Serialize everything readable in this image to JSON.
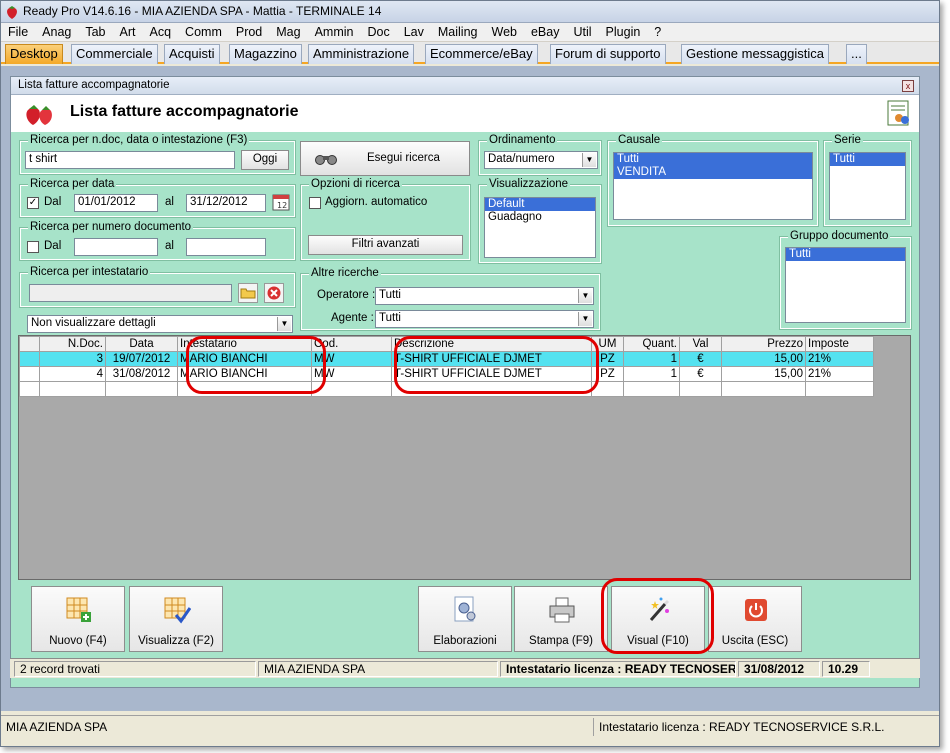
{
  "app": {
    "title": "Ready Pro V14.6.16 - MIA AZIENDA SPA - Mattia - TERMINALE 14"
  },
  "menu": [
    "File",
    "Anag",
    "Tab",
    "Art",
    "Acq",
    "Comm",
    "Prod",
    "Mag",
    "Ammin",
    "Doc",
    "Lav",
    "Mailing",
    "Web",
    "eBay",
    "Util",
    "Plugin",
    "?"
  ],
  "tabs": [
    "Desktop",
    "Commerciale",
    "Acquisti",
    "Magazzino",
    "Amministrazione",
    "Ecommerce/eBay",
    "Forum di supporto",
    "Gestione messaggistica",
    "..."
  ],
  "window": {
    "title": "Lista fatture accompagnatorie",
    "heading": "Lista fatture accompagnatorie",
    "close_glyph": "x"
  },
  "search": {
    "legend": "Ricerca per n.doc, data o intestazione (F3)",
    "value": "t shirt",
    "today_button": "Oggi",
    "execute_button": "Esegui ricerca"
  },
  "date_search": {
    "legend": "Ricerca per data",
    "from_label": "Dal",
    "from_checked": true,
    "from": "01/01/2012",
    "to_label": "al",
    "to": "31/12/2012"
  },
  "number_search": {
    "legend": "Ricerca per numero documento",
    "from_label": "Dal",
    "to_label": "al"
  },
  "holder_search": {
    "legend": "Ricerca per intestatario"
  },
  "details_select": "Non visualizzare dettagli",
  "options": {
    "legend": "Opzioni di ricerca",
    "auto_update": "Aggiorn. automatico",
    "advanced_filters": "Filtri avanzati"
  },
  "other_search": {
    "legend": "Altre ricerche",
    "operator_label": "Operatore :",
    "operator_value": "Tutti",
    "agent_label": "Agente :",
    "agent_value": "Tutti"
  },
  "ordering": {
    "legend": "Ordinamento",
    "value": "Data/numero"
  },
  "view": {
    "legend": "Visualizzazione",
    "items": [
      "Default",
      "Guadagno"
    ]
  },
  "causale": {
    "legend": "Causale",
    "items": [
      "Tutti",
      "VENDITA"
    ]
  },
  "serie": {
    "legend": "Serie",
    "items": [
      "Tutti"
    ]
  },
  "doc_group": {
    "legend": "Gruppo documento",
    "items": [
      "Tutti"
    ]
  },
  "grid": {
    "columns": [
      "",
      "N.Doc.",
      "Data",
      "Intestatario",
      "Cod.",
      "Descrizione",
      "UM",
      "Quant.",
      "Val",
      "Prezzo",
      "Imposte"
    ],
    "rows": [
      [
        "",
        "3",
        "19/07/2012",
        "MARIO BIANCHI",
        "MW",
        "T-SHIRT UFFICIALE DJMET",
        "PZ",
        "1",
        "€",
        "15,00",
        "21%"
      ],
      [
        "",
        "4",
        "31/08/2012",
        "MARIO BIANCHI",
        "MW",
        "T-SHIRT UFFICIALE DJMET",
        "PZ",
        "1",
        "€",
        "15,00",
        "21%"
      ]
    ]
  },
  "toolbar": {
    "new": "Nuovo (F4)",
    "view": "Visualizza (F2)",
    "processing": "Elaborazioni",
    "print": "Stampa (F9)",
    "visual": "Visual (F10)",
    "exit": "Uscita (ESC)"
  },
  "status": {
    "records": "2 record trovati",
    "company": "MIA AZIENDA SPA",
    "license": "Intestatario licenza : READY TECNOSER",
    "date": "31/08/2012",
    "time": "10.29"
  },
  "app_status": {
    "company": "MIA AZIENDA SPA",
    "license": "Intestatario licenza : READY TECNOSERVICE S.R.L."
  },
  "colors": {
    "form_bg": "#a7e3c9",
    "selection": "#3a6fd8",
    "highlight_row": "#54e2f0",
    "annotation": "#e00000",
    "active_tab": "#f4a928"
  }
}
